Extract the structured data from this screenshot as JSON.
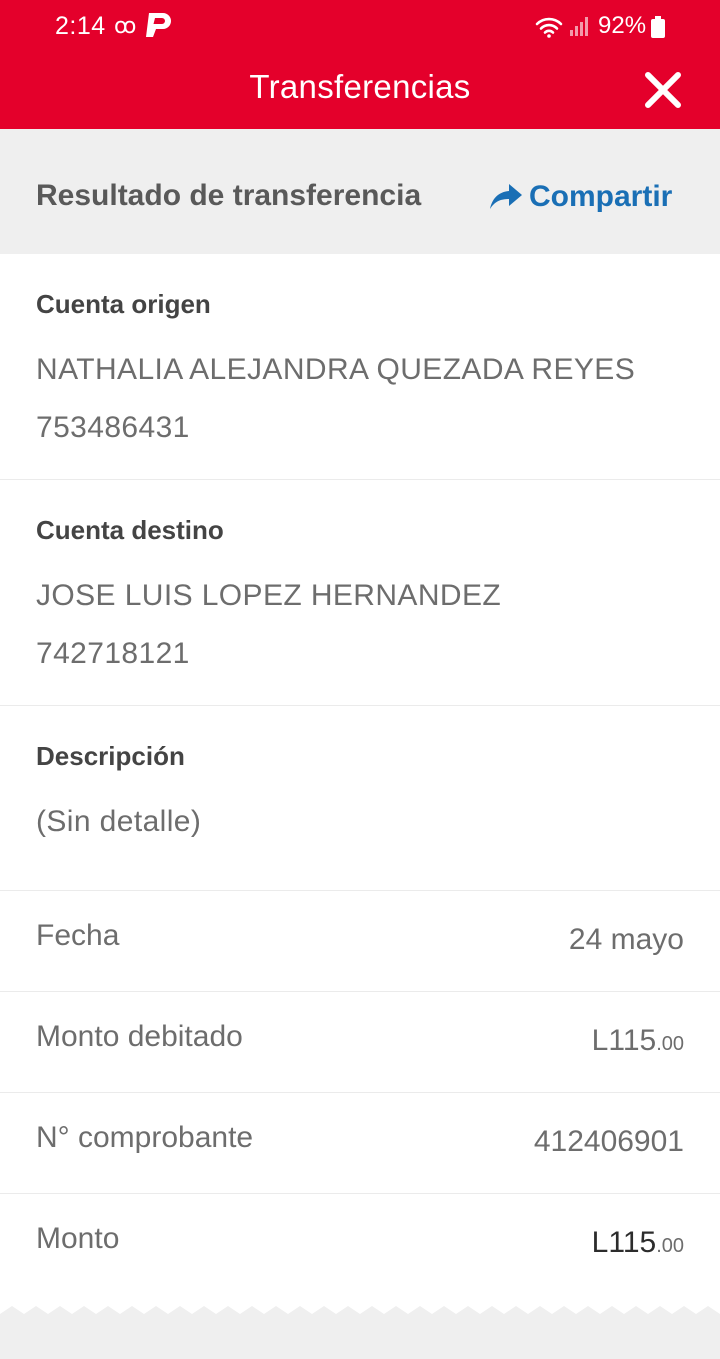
{
  "status_bar": {
    "time": "2:14",
    "voicemail_icon": "voicemail-icon",
    "battery": "92%"
  },
  "header": {
    "title": "Transferencias",
    "close_icon": "close-icon",
    "color": "#e4002b"
  },
  "subheader": {
    "title": "Resultado de transferencia",
    "share_label": "Compartir",
    "share_icon": "share-arrow-icon",
    "accent": "#1a6fb5"
  },
  "origin": {
    "label": "Cuenta origen",
    "name": "NATHALIA ALEJANDRA QUEZADA REYES",
    "account": "753486431"
  },
  "destination": {
    "label": "Cuenta destino",
    "name": "JOSE LUIS LOPEZ HERNANDEZ",
    "account": "742718121"
  },
  "description": {
    "label": "Descripción",
    "value": "(Sin detalle)"
  },
  "details": {
    "date_label": "Fecha",
    "date_value": "24 mayo",
    "debited_label": "Monto debitado",
    "debited_main": "L115",
    "debited_cents": ".00",
    "receipt_label": "N° comprobante",
    "receipt_value": "412406901",
    "amount_label": "Monto",
    "amount_main": "L115",
    "amount_cents": ".00"
  }
}
